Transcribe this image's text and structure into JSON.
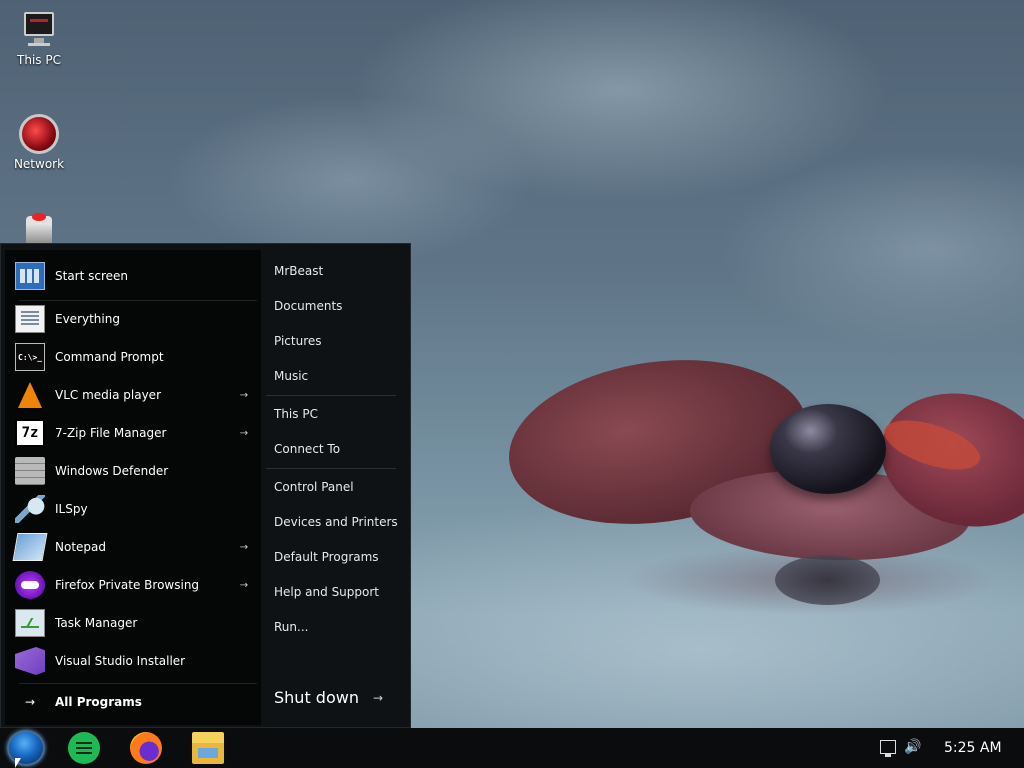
{
  "desktop": {
    "icons": [
      {
        "label": "This PC",
        "icon": "computer-icon"
      },
      {
        "label": "Network",
        "icon": "network-icon"
      },
      {
        "label": "",
        "icon": "recycle-bin-icon"
      }
    ]
  },
  "start_menu": {
    "left_items": [
      {
        "label": "Start screen",
        "icon": "start-screen-icon",
        "has_submenu": false
      },
      {
        "label": "Everything",
        "icon": "everything-icon",
        "has_submenu": false
      },
      {
        "label": "Command Prompt",
        "icon": "command-prompt-icon",
        "icon_text": "C:\\>_",
        "has_submenu": false
      },
      {
        "label": "VLC media player",
        "icon": "vlc-icon",
        "has_submenu": true
      },
      {
        "label": "7-Zip File Manager",
        "icon": "7zip-icon",
        "icon_text": "7z",
        "has_submenu": true
      },
      {
        "label": "Windows Defender",
        "icon": "windows-defender-icon",
        "has_submenu": false
      },
      {
        "label": "ILSpy",
        "icon": "ilspy-icon",
        "has_submenu": false
      },
      {
        "label": "Notepad",
        "icon": "notepad-icon",
        "has_submenu": true
      },
      {
        "label": "Firefox Private Browsing",
        "icon": "firefox-private-icon",
        "has_submenu": true
      },
      {
        "label": "Task Manager",
        "icon": "task-manager-icon",
        "has_submenu": false
      },
      {
        "label": "Visual Studio Installer",
        "icon": "visual-studio-installer-icon",
        "has_submenu": false
      }
    ],
    "all_programs_label": "All Programs",
    "arrow_glyph": "→",
    "right_items": [
      "MrBeast",
      "Documents",
      "Pictures",
      "Music",
      "This PC",
      "Connect To",
      "Control Panel",
      "Devices and Printers",
      "Default Programs",
      "Help and Support",
      "Run..."
    ],
    "shutdown_label": "Shut down"
  },
  "taskbar": {
    "apps": [
      "start-orb-icon",
      "notes-app-icon",
      "firefox-icon",
      "file-explorer-icon"
    ],
    "tray": {
      "network_icon": "network-tray-icon",
      "volume_icon": "volume-icon",
      "volume_glyph": "🔊",
      "clock": "5:25 AM"
    }
  },
  "colors": {
    "menu_bg": "#0f1214",
    "menu_left_bg": "#050606",
    "taskbar_bg": "#0b0c0d",
    "text": "#ffffff"
  }
}
